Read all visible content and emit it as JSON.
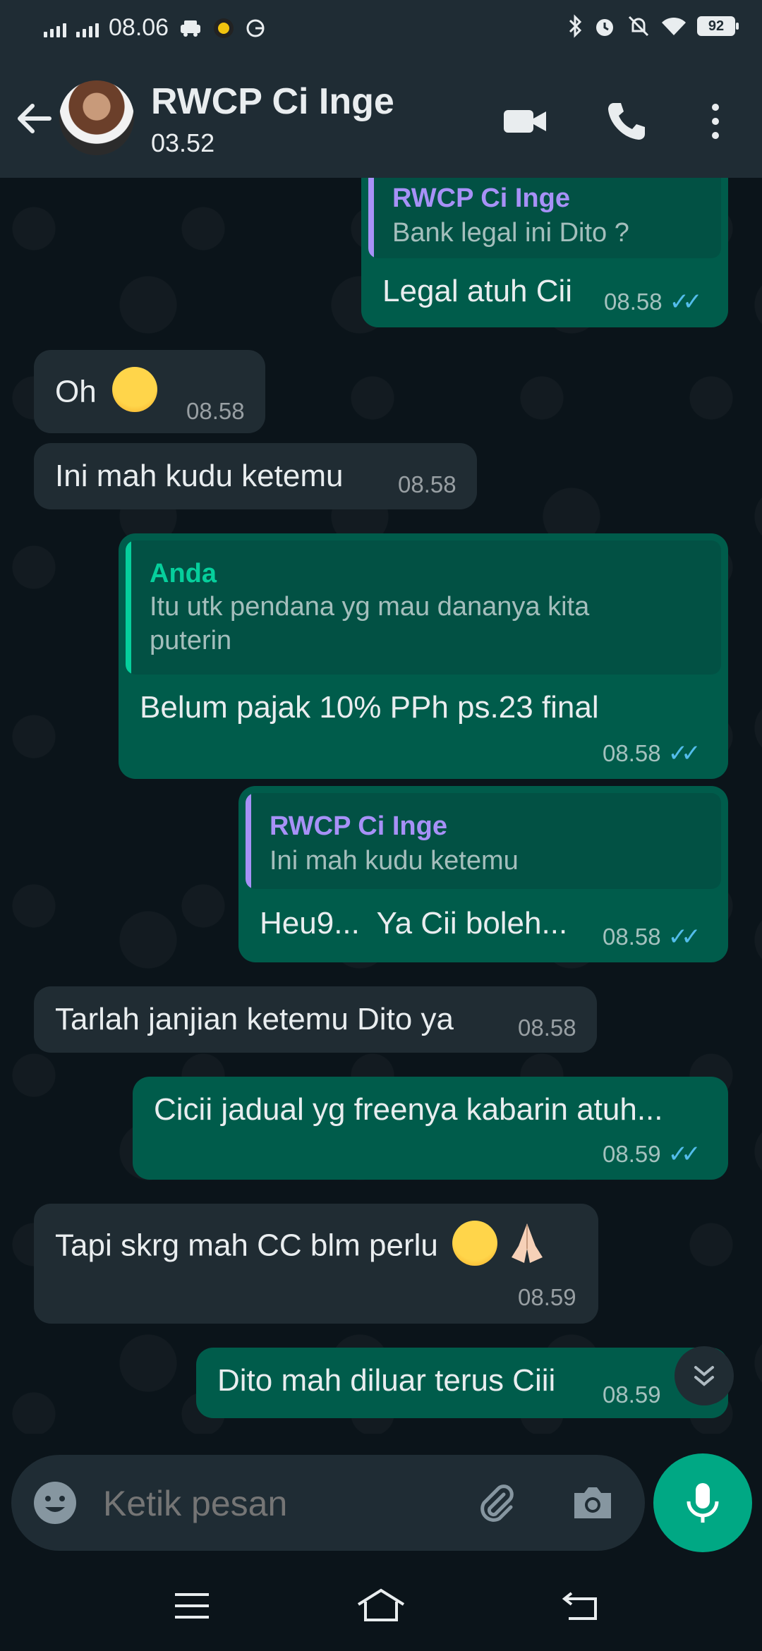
{
  "status_bar": {
    "time": "08.06",
    "battery": "92"
  },
  "header": {
    "contact_name": "RWCP Ci Inge",
    "contact_status": "03.52"
  },
  "messages": [
    {
      "quote_name": "RWCP Ci Inge",
      "quote_text": "Bank legal ini Dito ?",
      "text": "Legal atuh Cii",
      "time": "08.58"
    },
    {
      "text": "Oh",
      "time": "08.58"
    },
    {
      "text": "Ini mah kudu ketemu",
      "time": "08.58"
    },
    {
      "quote_name": "Anda",
      "quote_text_1": "Itu utk pendana yg mau dananya kita",
      "quote_text_2": "puterin",
      "text": "Belum pajak 10% PPh ps.23 final",
      "time": "08.58"
    },
    {
      "quote_name": "RWCP Ci Inge",
      "quote_text": "Ini mah kudu ketemu",
      "text": "Heu9...  Ya Cii boleh...",
      "time": "08.58"
    },
    {
      "text": "Tarlah janjian ketemu Dito ya",
      "time": "08.58"
    },
    {
      "text": "Cicii jadual yg freenya kabarin atuh...",
      "time": "08.59"
    },
    {
      "text": "Tapi skrg mah CC blm perlu",
      "time": "08.59"
    },
    {
      "text": "Dito mah diluar terus Ciii",
      "time": "08.59"
    }
  ],
  "input": {
    "placeholder": "Ketik pesan"
  },
  "colors": {
    "incoming": "#202c33",
    "outgoing": "#005c4b",
    "accent": "#00a884",
    "read_ticks": "#53bdeb"
  }
}
